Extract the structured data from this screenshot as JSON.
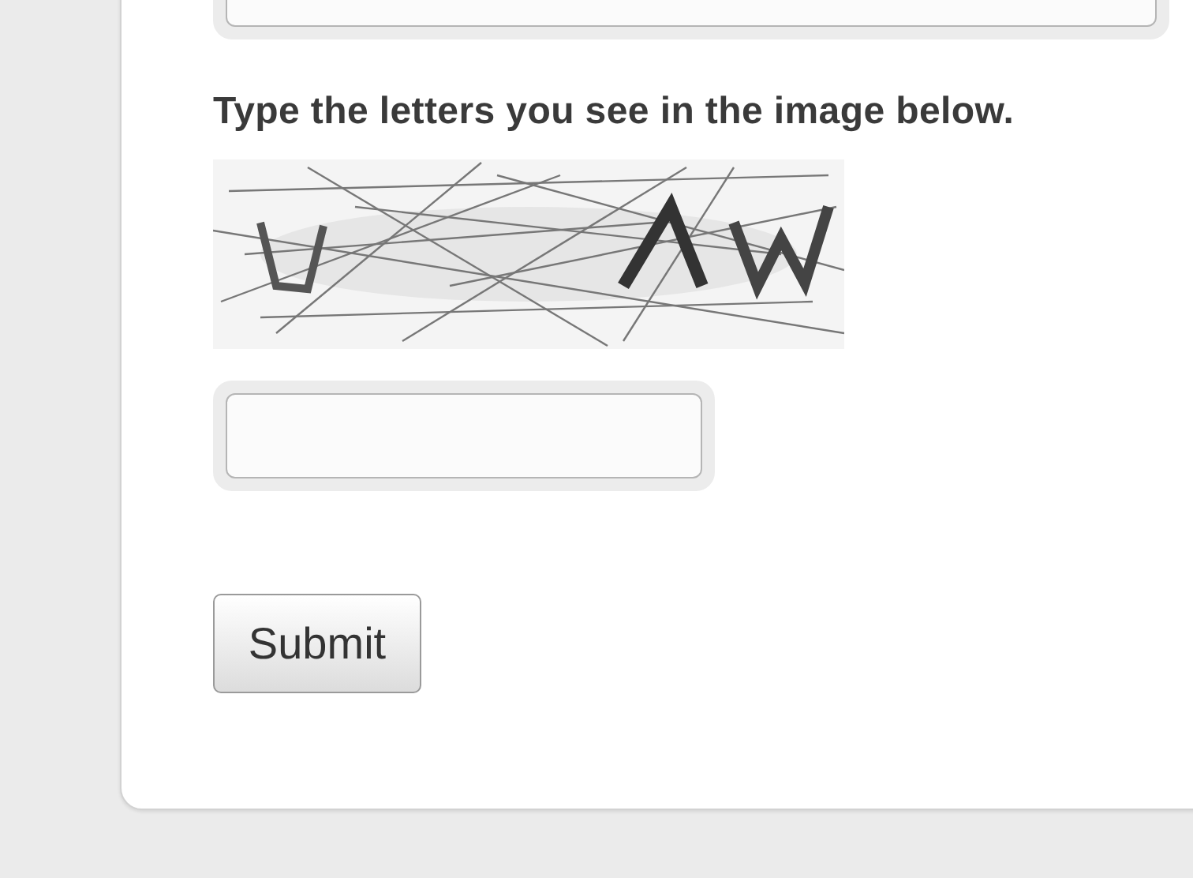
{
  "previous_field": {
    "kind": "input"
  },
  "captcha": {
    "label": "Type the letters you see in the image below.",
    "answer": {
      "kind": "input"
    }
  },
  "submit": {
    "label": "Submit"
  }
}
